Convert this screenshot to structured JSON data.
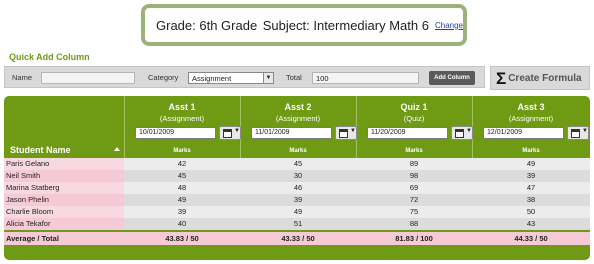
{
  "header": {
    "grade_text": "Grade: 6th Grade",
    "subject_text": "Subject: Intermediary Math 6",
    "change_link": "Change"
  },
  "quick_add": {
    "title": "Quick Add Column",
    "name_label": "Name",
    "name_value": "",
    "category_label": "Category",
    "category_value": "Assignment",
    "total_label": "Total",
    "total_value": "100",
    "add_button": "Add Column"
  },
  "create_formula": {
    "label": "Create Formula",
    "icon": "sigma-icon"
  },
  "grid": {
    "student_header": "Student Name",
    "marks_label": "Marks",
    "columns": [
      {
        "title": "Asst 1",
        "type": "(Assignment)",
        "date": "10/01/2009"
      },
      {
        "title": "Asst 2",
        "type": "(Assignment)",
        "date": "11/01/2009"
      },
      {
        "title": "Quiz 1",
        "type": "(Quiz)",
        "date": "11/20/2009"
      },
      {
        "title": "Asst 3",
        "type": "(Assignment)",
        "date": "12/01/2009"
      }
    ],
    "rows": [
      {
        "name": "Paris Gelano",
        "marks": [
          "42",
          "45",
          "89",
          "49"
        ]
      },
      {
        "name": "Neil Smith",
        "marks": [
          "45",
          "30",
          "98",
          "39"
        ]
      },
      {
        "name": "Marina Statberg",
        "marks": [
          "48",
          "46",
          "69",
          "47"
        ]
      },
      {
        "name": "Jason Phelin",
        "marks": [
          "49",
          "39",
          "72",
          "38"
        ]
      },
      {
        "name": "Charlie Bloom",
        "marks": [
          "39",
          "49",
          "75",
          "50"
        ]
      },
      {
        "name": "Alicia Tekafor",
        "marks": [
          "40",
          "51",
          "88",
          "43"
        ]
      }
    ],
    "average": {
      "label": "Average / Total",
      "values": [
        "43.83 / 50",
        "43.33 / 50",
        "81.83 / 100",
        "44.33 / 50"
      ]
    }
  },
  "colors": {
    "accent_green": "#6f9a13",
    "header_border": "#9bb37a",
    "name_pink": "#f5cad6"
  }
}
